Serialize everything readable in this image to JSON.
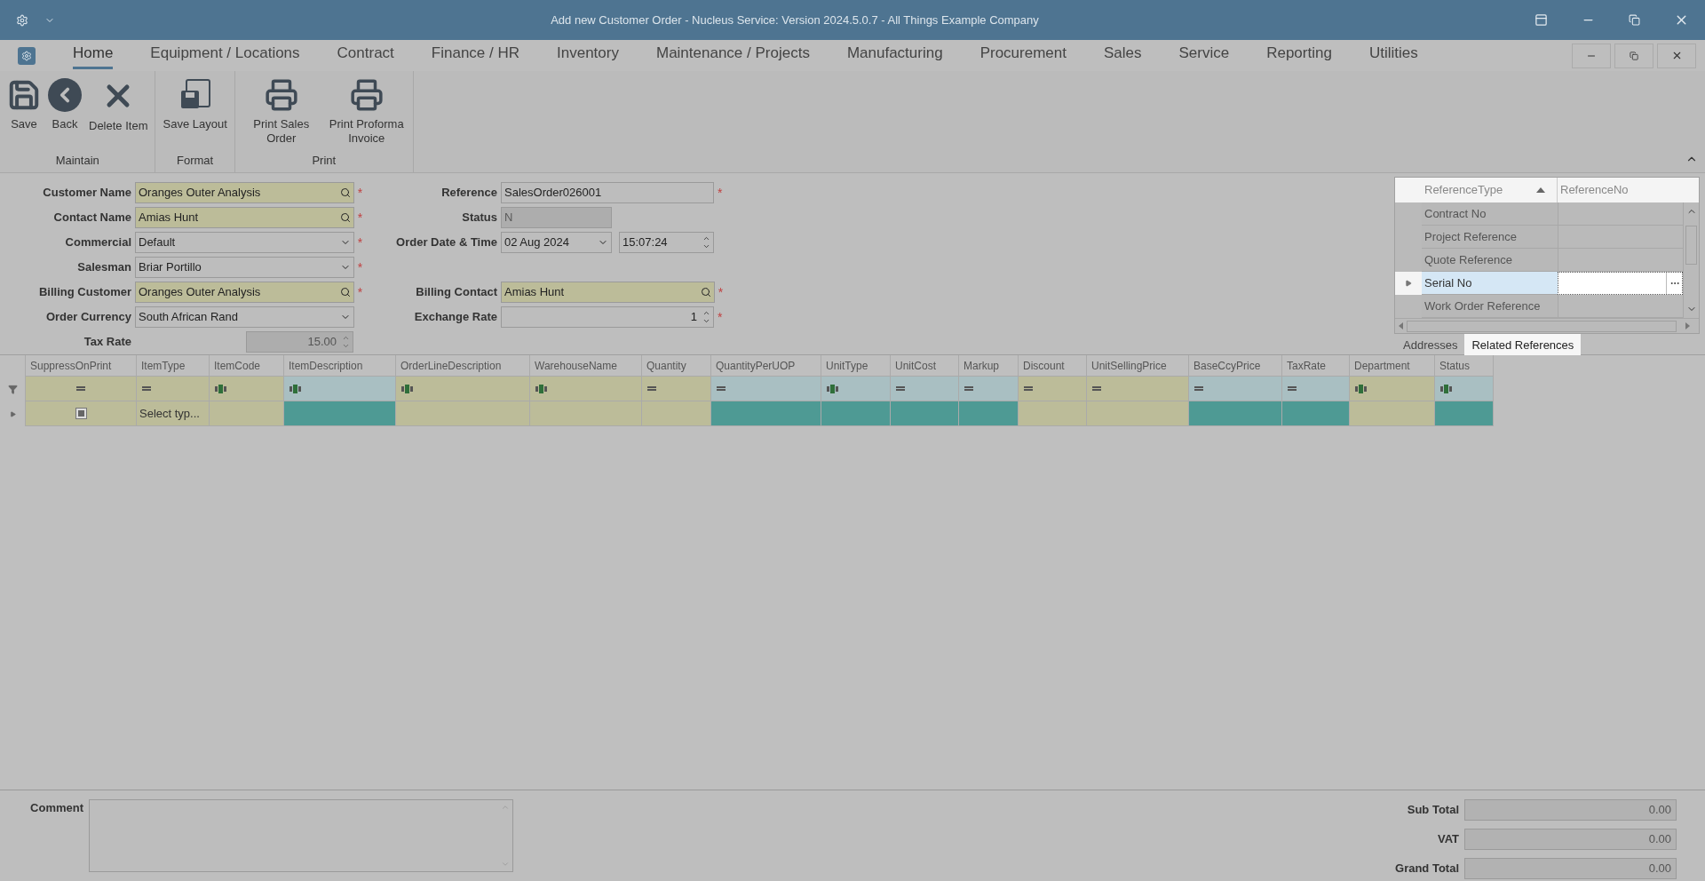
{
  "window": {
    "title": "Add new Customer Order - Nucleus Service: Version 2024.5.0.7 - All Things Example Company"
  },
  "ribbon": {
    "tabs": [
      {
        "label": "Home",
        "selected": true
      },
      {
        "label": "Equipment / Locations",
        "selected": false
      },
      {
        "label": "Contract",
        "selected": false
      },
      {
        "label": "Finance / HR",
        "selected": false
      },
      {
        "label": "Inventory",
        "selected": false
      },
      {
        "label": "Maintenance / Projects",
        "selected": false
      },
      {
        "label": "Manufacturing",
        "selected": false
      },
      {
        "label": "Procurement",
        "selected": false
      },
      {
        "label": "Sales",
        "selected": false
      },
      {
        "label": "Service",
        "selected": false
      },
      {
        "label": "Reporting",
        "selected": false
      },
      {
        "label": "Utilities",
        "selected": false
      }
    ],
    "groups": [
      {
        "label": "Maintain",
        "buttons": [
          {
            "label": "Save",
            "kind": "save"
          },
          {
            "label": "Back",
            "kind": "back"
          },
          {
            "label": "Delete Item",
            "kind": "delete"
          }
        ]
      },
      {
        "label": "Format",
        "buttons": [
          {
            "label": "Save Layout",
            "kind": "layout"
          }
        ]
      },
      {
        "label": "Print",
        "buttons": [
          {
            "label": "Print Sales Order",
            "kind": "print"
          },
          {
            "label": "Print Proforma Invoice",
            "kind": "print"
          }
        ]
      }
    ]
  },
  "form": {
    "rows": [
      {
        "left": {
          "label": "Customer Name",
          "value": "Oranges Outer Analysis",
          "kind": "lookup",
          "required_mark": "*",
          "highlighted": true,
          "disabled": false
        },
        "right": {
          "label": "Reference",
          "value": "SalesOrder026001",
          "kind": "text",
          "required_mark": "*",
          "highlighted": false,
          "disabled": false
        }
      },
      {
        "left": {
          "label": "Contact Name",
          "value": "Amias Hunt",
          "kind": "lookup",
          "required_mark": "*",
          "highlighted": true,
          "disabled": false
        },
        "right": {
          "label": "Status",
          "value": "N",
          "kind": "text",
          "highlighted": false,
          "disabled": true
        }
      },
      {
        "left": {
          "label": "Commercial",
          "value": "Default",
          "kind": "dropdown",
          "required_mark": "*",
          "highlighted": false,
          "disabled": false
        },
        "right": {
          "label": "Order Date & Time",
          "date": "02 Aug 2024",
          "time": "15:07:24",
          "kind": "datetime",
          "highlighted": false,
          "disabled": false
        }
      },
      {
        "left": {
          "label": "Salesman",
          "value": "Briar Portillo",
          "kind": "dropdown",
          "required_mark": "*",
          "highlighted": false,
          "disabled": false
        }
      },
      {
        "left": {
          "label": "Billing Customer",
          "value": "Oranges Outer Analysis",
          "kind": "lookup",
          "required_mark": "*",
          "highlighted": true,
          "disabled": false
        },
        "right": {
          "label": "Billing Contact",
          "value": "Amias Hunt",
          "kind": "lookup",
          "required_mark": "*",
          "highlighted": true,
          "disabled": false
        }
      },
      {
        "left": {
          "label": "Order Currency",
          "value": "South African Rand",
          "kind": "dropdown",
          "highlighted": false,
          "disabled": false
        },
        "right": {
          "label": "Exchange Rate",
          "value": "1",
          "kind": "spin",
          "required_mark": "*",
          "highlighted": false,
          "disabled": false
        }
      },
      {
        "left": {
          "label": "Tax Rate",
          "value": "15.00",
          "kind": "spin",
          "highlighted": false,
          "disabled": true
        }
      }
    ]
  },
  "references": {
    "columns": [
      "ReferenceType",
      "ReferenceNo"
    ],
    "rows": [
      {
        "type": "Contract No",
        "selected": false
      },
      {
        "type": "Project Reference",
        "selected": false
      },
      {
        "type": "Quote Reference",
        "selected": false
      },
      {
        "type": "Serial No",
        "selected": true
      },
      {
        "type": "Work Order Reference",
        "selected": false
      }
    ],
    "tabs": [
      {
        "label": "Addresses",
        "selected": false
      },
      {
        "label": "Related References",
        "selected": true
      }
    ]
  },
  "grid": {
    "columns": [
      {
        "name": "SuppressOnPrint",
        "text_filter": false,
        "readonly": false
      },
      {
        "name": "ItemType",
        "text_filter": false,
        "readonly": false
      },
      {
        "name": "ItemCode",
        "text_filter": true,
        "readonly": false
      },
      {
        "name": "ItemDescription",
        "text_filter": true,
        "readonly": true
      },
      {
        "name": "OrderLineDescription",
        "text_filter": true,
        "readonly": false
      },
      {
        "name": "WarehouseName",
        "text_filter": true,
        "readonly": false
      },
      {
        "name": "Quantity",
        "text_filter": false,
        "readonly": false
      },
      {
        "name": "QuantityPerUOP",
        "text_filter": false,
        "readonly": true
      },
      {
        "name": "UnitType",
        "text_filter": true,
        "readonly": true
      },
      {
        "name": "UnitCost",
        "text_filter": false,
        "readonly": true
      },
      {
        "name": "Markup",
        "text_filter": false,
        "readonly": true
      },
      {
        "name": "Discount",
        "text_filter": false,
        "readonly": false
      },
      {
        "name": "UnitSellingPrice",
        "text_filter": false,
        "readonly": false
      },
      {
        "name": "BaseCcyPrice",
        "text_filter": false,
        "readonly": true
      },
      {
        "name": "TaxRate",
        "text_filter": false,
        "readonly": true
      },
      {
        "name": "Department",
        "text_filter": true,
        "readonly": false
      },
      {
        "name": "Status",
        "text_filter": true,
        "readonly": true
      }
    ],
    "new_row_cells": [
      {
        "kind": "checkbox"
      },
      {
        "kind": "text",
        "text": "Select typ..."
      }
    ]
  },
  "footer": {
    "comment_label": "Comment",
    "totals": [
      {
        "label": "Sub Total",
        "value": "0.00"
      },
      {
        "label": "VAT",
        "value": "0.00"
      },
      {
        "label": "Grand Total",
        "value": "0.00"
      }
    ]
  }
}
